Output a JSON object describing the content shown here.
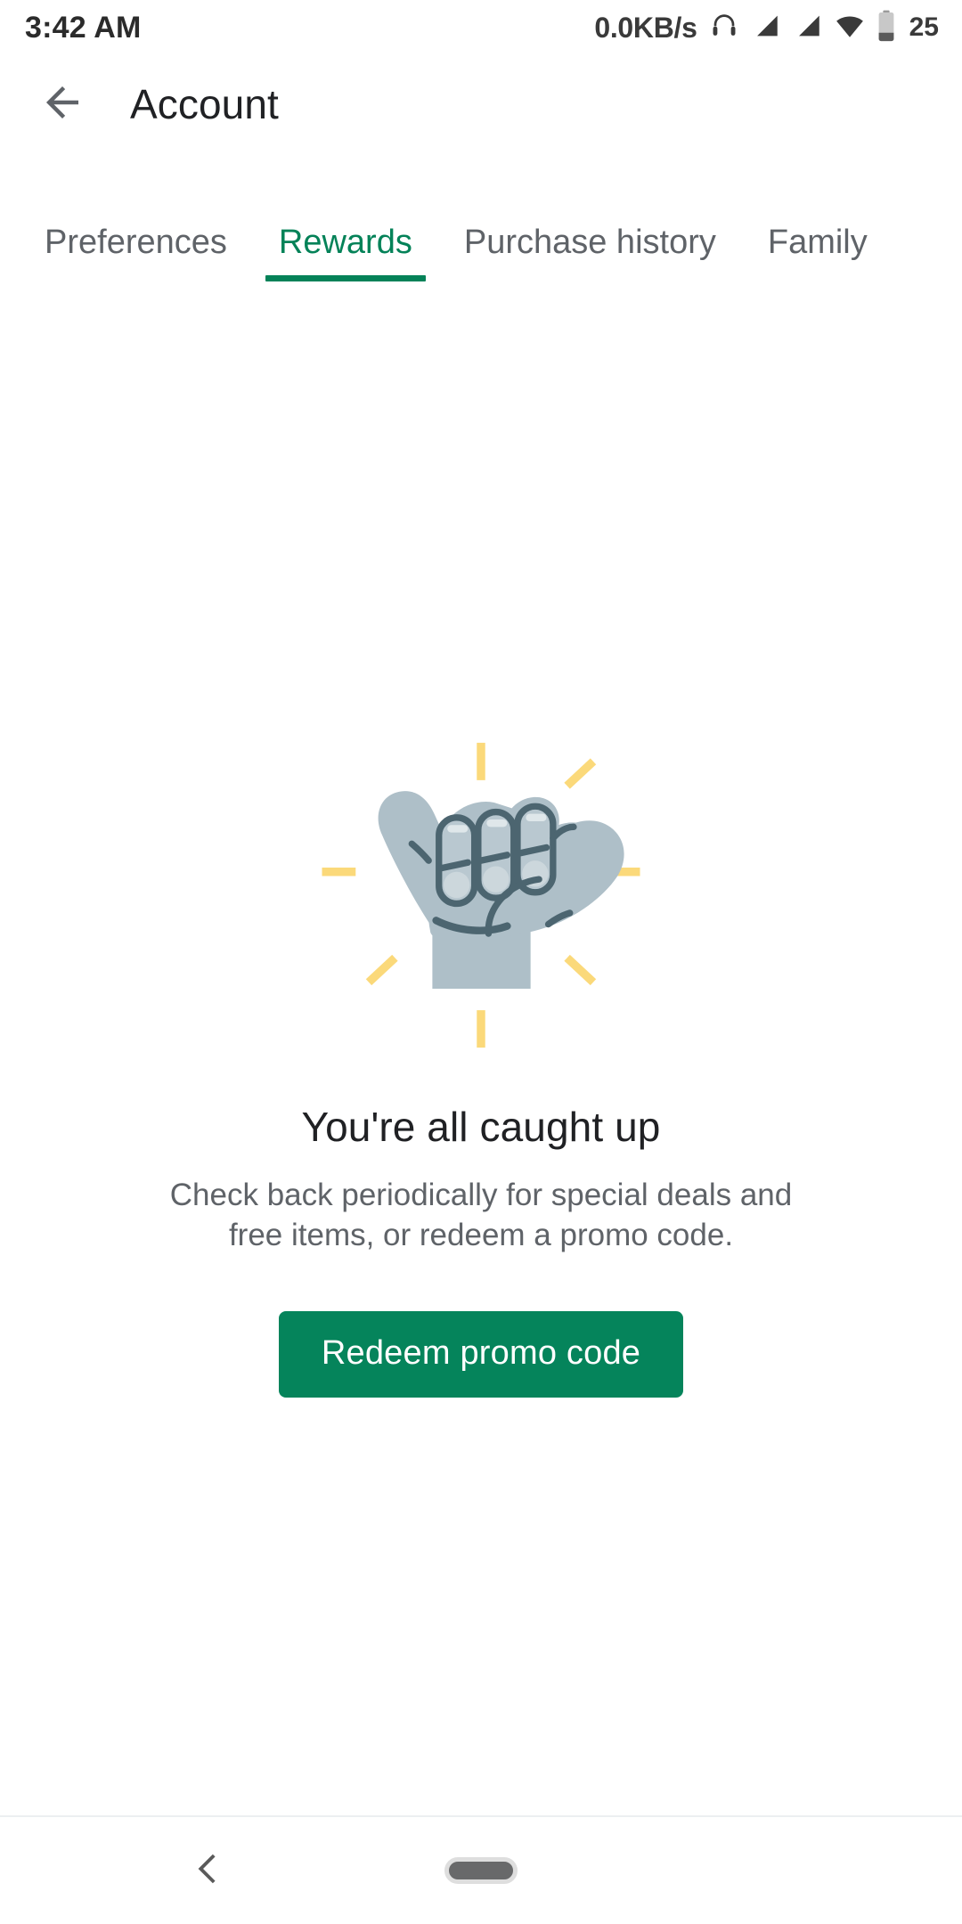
{
  "status_bar": {
    "time": "3:42 AM",
    "network_speed": "0.0KB/s",
    "battery_percent": "25",
    "icons": [
      "headphones-icon",
      "signal-cellular-1-icon",
      "signal-cellular-2-icon",
      "wifi-icon",
      "battery-icon"
    ]
  },
  "app_bar": {
    "back_icon": "arrow-back-icon",
    "title": "Account"
  },
  "tabs": {
    "items": [
      {
        "label": "Preferences",
        "active": false
      },
      {
        "label": "Rewards",
        "active": true
      },
      {
        "label": "Purchase history",
        "active": false
      },
      {
        "label": "Family",
        "active": false
      }
    ],
    "active_index": 1,
    "active_color": "#048258",
    "inactive_color": "#5f6368"
  },
  "empty_state": {
    "illustration": "shaka-hand-icon",
    "title": "You're all caught up",
    "subtitle": "Check back periodically for special deals and free items, or redeem a promo code.",
    "button_label": "Redeem promo code",
    "button_color": "#05845B",
    "hand_color": "#aebfc8",
    "hand_outline_color": "#4c6570",
    "ray_color": "#fbd97a"
  },
  "nav_bar": {
    "back_icon": "chevron-left-icon",
    "home_icon": "home-pill-icon"
  }
}
